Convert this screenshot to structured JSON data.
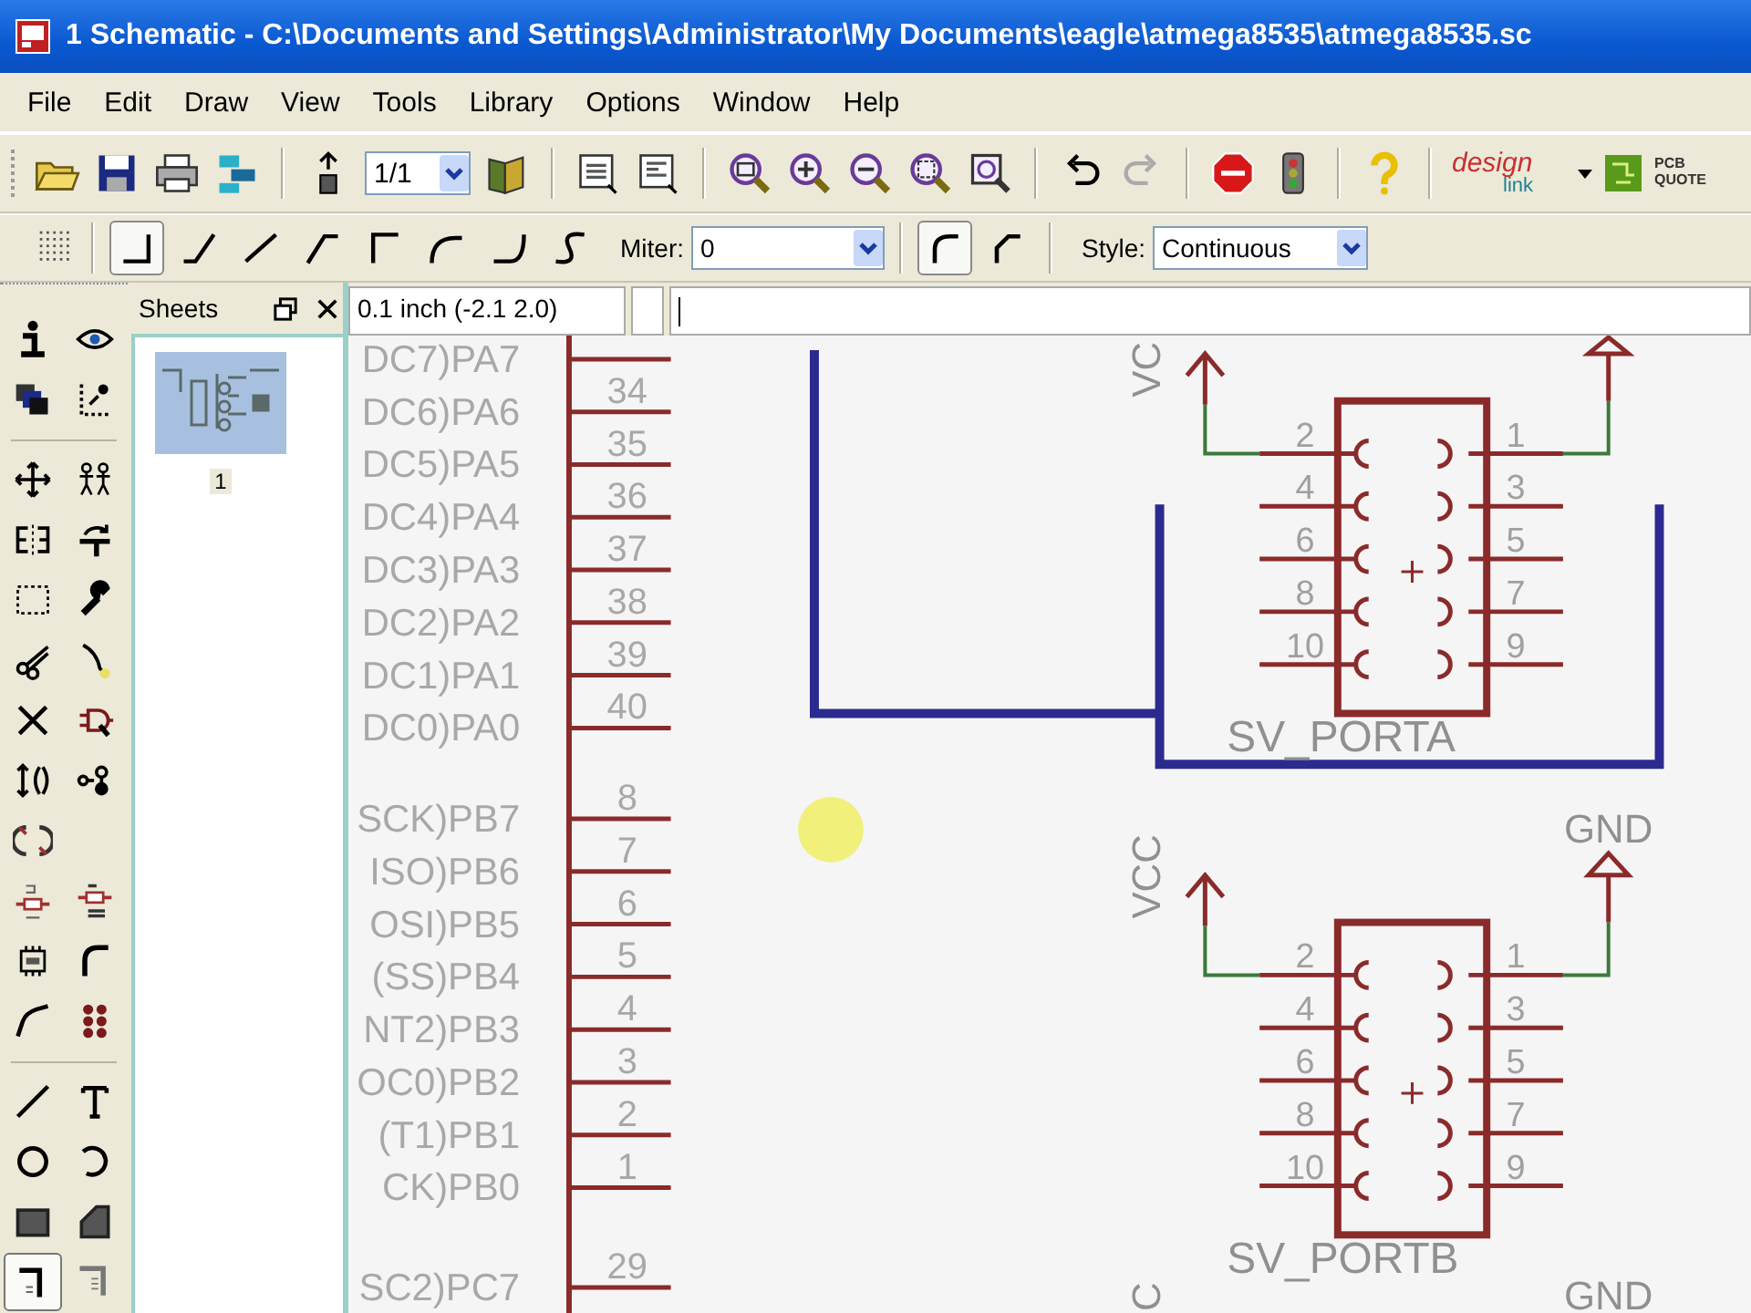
{
  "window": {
    "title": "1 Schematic - C:\\Documents and Settings\\Administrator\\My Documents\\eagle\\atmega8535\\atmega8535.sc"
  },
  "menu": [
    "File",
    "Edit",
    "Draw",
    "View",
    "Tools",
    "Library",
    "Options",
    "Window",
    "Help"
  ],
  "toolbar": {
    "zoom_value": "1/1",
    "design_link": [
      "design",
      "link"
    ],
    "pcb_quote": [
      "PCB",
      "QUOTE"
    ]
  },
  "wire_toolbar": {
    "bend_modes": [
      {
        "selected": true
      },
      {
        "selected": false
      },
      {
        "selected": false
      },
      {
        "selected": false
      },
      {
        "selected": false
      },
      {
        "selected": false
      },
      {
        "selected": false
      },
      {
        "selected": false
      }
    ],
    "miter_label": "Miter:",
    "miter_value": "0",
    "miter_modes": [
      {
        "selected": true
      },
      {
        "selected": false
      }
    ],
    "style_label": "Style:",
    "style_value": "Continuous"
  },
  "tool_palette": [
    {
      "tools": [
        {
          "selected": false
        },
        {
          "selected": false
        },
        {
          "selected": false
        },
        {
          "selected": false
        }
      ]
    },
    {
      "tools": [
        {
          "selected": false
        },
        {
          "selected": false
        },
        {
          "selected": false
        },
        {
          "selected": false
        },
        {
          "selected": false
        },
        {
          "selected": false
        },
        {
          "selected": false
        },
        {
          "selected": false
        },
        {
          "selected": false
        },
        {
          "selected": false
        },
        {
          "selected": false
        },
        {
          "selected": false
        },
        {
          "selected": false
        },
        {
          "selected": false
        },
        {
          "selected": false
        },
        {
          "selected": false
        },
        {
          "selected": false
        },
        {
          "selected": false
        },
        {
          "selected": false
        }
      ]
    },
    {
      "tools": [
        {
          "selected": false
        },
        {
          "selected": false
        },
        {
          "selected": false
        },
        {
          "selected": false
        },
        {
          "selected": false
        },
        {
          "selected": false
        },
        {
          "selected": true
        },
        {
          "selected": false
        }
      ]
    }
  ],
  "sheets_panel": {
    "title": "Sheets",
    "sheets": [
      {
        "label": "1",
        "selected": true
      }
    ]
  },
  "coordinates": "0.1 inch (-2.1 2.0)",
  "schematic": {
    "pin_groups": [
      {
        "pins": [
          {
            "label": "DC7)PA7"
          },
          {
            "label": "DC6)PA6",
            "number": "34"
          },
          {
            "label": "DC5)PA5",
            "number": "35"
          },
          {
            "label": "DC4)PA4",
            "number": "36"
          },
          {
            "label": "DC3)PA3",
            "number": "37"
          },
          {
            "label": "DC2)PA2",
            "number": "38"
          },
          {
            "label": "DC1)PA1",
            "number": "39"
          },
          {
            "label": "DC0)PA0",
            "number": "40"
          }
        ]
      },
      {
        "pins": [
          {
            "label": "SCK)PB7",
            "number": "8"
          },
          {
            "label": "ISO)PB6",
            "number": "7"
          },
          {
            "label": "OSI)PB5",
            "number": "6"
          },
          {
            "label": "(SS)PB4",
            "number": "5"
          },
          {
            "label": "NT2)PB3",
            "number": "4"
          },
          {
            "label": "OC0)PB2",
            "number": "3"
          },
          {
            "label": "(T1)PB1",
            "number": "2"
          },
          {
            "label": "CK)PB0",
            "number": "1"
          }
        ]
      },
      {
        "pins": [
          {
            "label": "SC2)PC7",
            "number": "29"
          }
        ]
      }
    ],
    "headers": [
      {
        "name": "SV_PORTA",
        "left_pins": [
          "2",
          "4",
          "6",
          "8",
          "10"
        ],
        "right_pins": [
          "1",
          "3",
          "5",
          "7",
          "9"
        ],
        "vcc_label": "VC"
      },
      {
        "name": "SV_PORTB",
        "left_pins": [
          "2",
          "4",
          "6",
          "8",
          "10"
        ],
        "right_pins": [
          "1",
          "3",
          "5",
          "7",
          "9"
        ],
        "vcc_label": "VCC",
        "gnd_label": "GND"
      }
    ],
    "bottom_labels": [
      {
        "kind": "vertical",
        "text": "C"
      },
      {
        "kind": "horizontal",
        "text": "GND"
      }
    ]
  }
}
